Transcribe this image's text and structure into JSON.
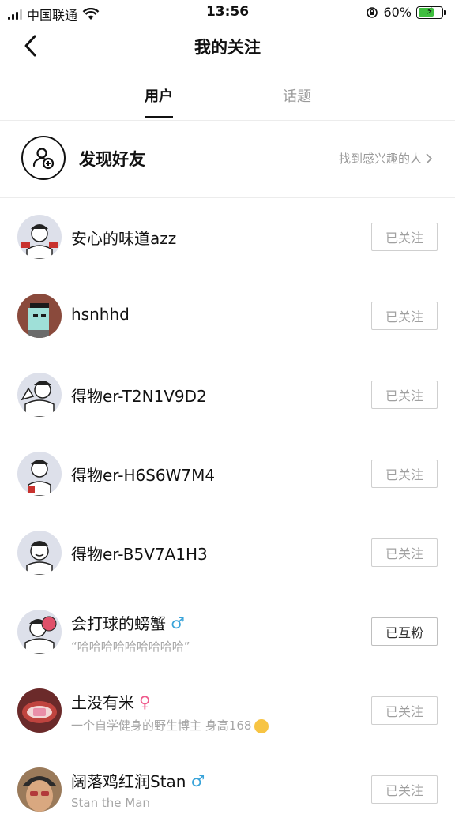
{
  "status_bar": {
    "carrier": "中国联通",
    "time": "13:56",
    "battery": "60%"
  },
  "nav": {
    "title": "我的关注"
  },
  "tabs": [
    {
      "label": "用户",
      "active": true
    },
    {
      "label": "话题",
      "active": false
    }
  ],
  "discover": {
    "title": "发现好友",
    "hint": "找到感兴趣的人"
  },
  "users": [
    {
      "name": "安心的味道azz",
      "gender": "",
      "bio": "",
      "button": "已关注"
    },
    {
      "name": "hsnhhd",
      "gender": "",
      "bio": "",
      "button": "已关注"
    },
    {
      "name": "得物er-T2N1V9D2",
      "gender": "",
      "bio": "",
      "button": "已关注"
    },
    {
      "name": "得物er-H6S6W7M4",
      "gender": "",
      "bio": "",
      "button": "已关注"
    },
    {
      "name": "得物er-B5V7A1H3",
      "gender": "",
      "bio": "",
      "button": "已关注"
    },
    {
      "name": "会打球的螃蟹",
      "gender": "♂",
      "bio": "“哈哈哈哈哈哈哈哈哈”",
      "button": "已互粉"
    },
    {
      "name": "土没有米",
      "gender": "♀",
      "bio": "一个自学健身的野生博主 身高168",
      "button": "已关注"
    },
    {
      "name": "阔落鸡红润Stan",
      "gender": "♂",
      "bio": "Stan the Man",
      "button": "已关注"
    }
  ],
  "colors": {
    "male": "#38a3d9",
    "female": "#ef5a8c",
    "battery_fill": "#3fbf3f"
  }
}
